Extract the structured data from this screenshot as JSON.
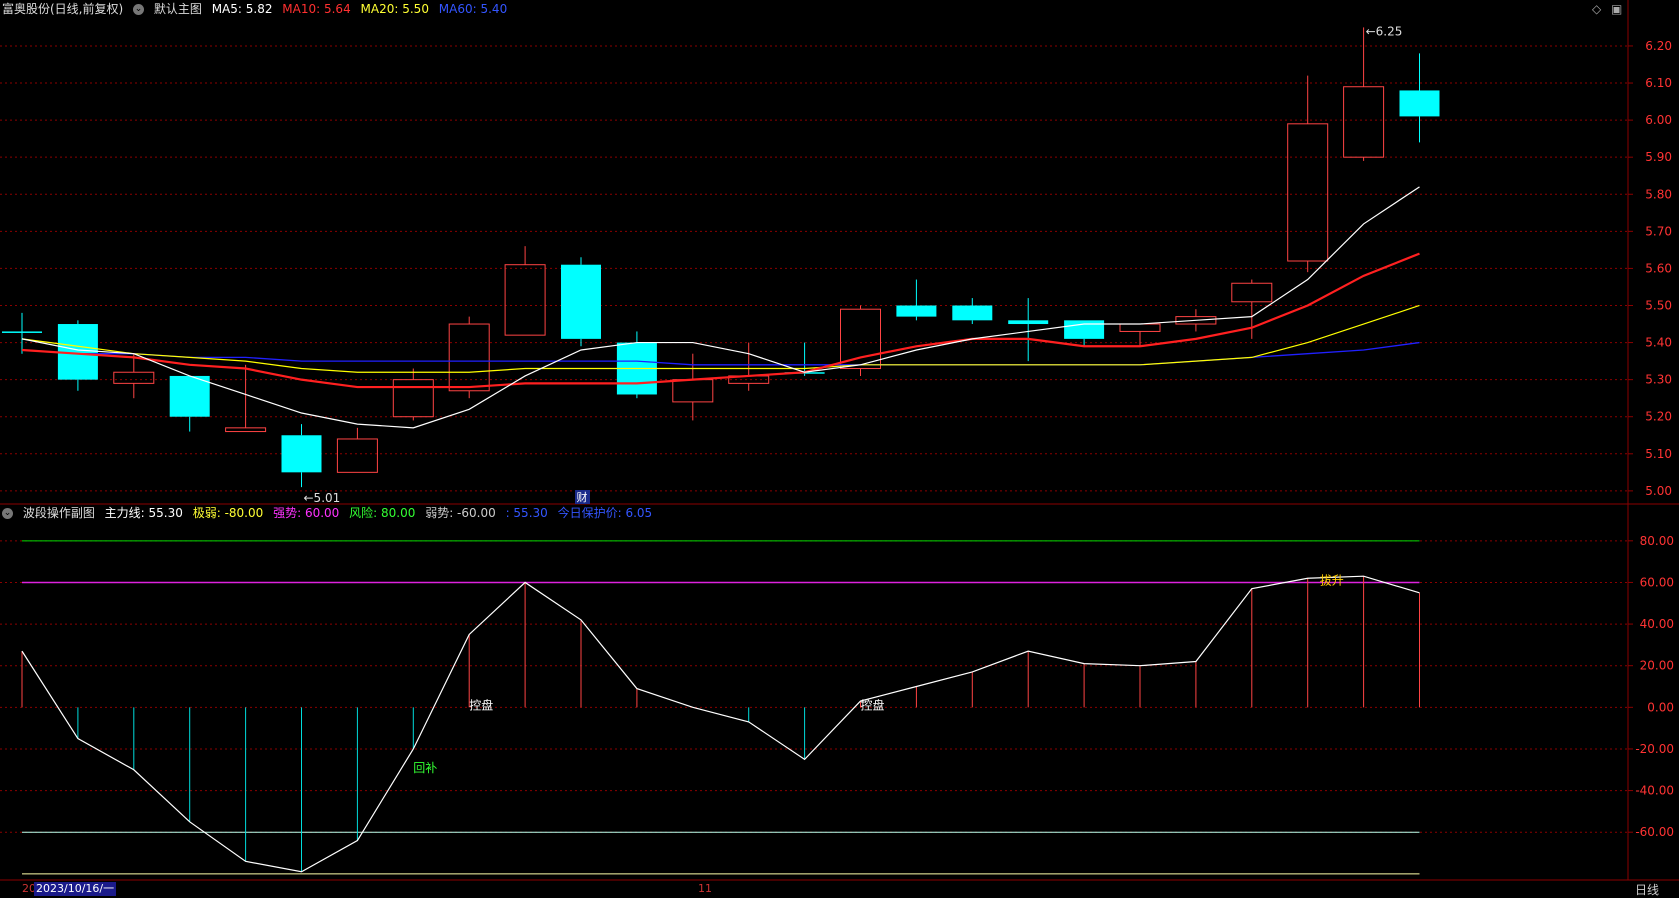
{
  "main_header": {
    "stock": "富奥股份(日线,前复权)",
    "chart_name": "默认主图",
    "ma5": "MA5: 5.82",
    "ma10": "MA10: 5.64",
    "ma20": "MA20: 5.50",
    "ma60": "MA60: 5.40"
  },
  "sub_header": {
    "name": "波段操作副图",
    "main_line": "主力线: 55.30",
    "extreme_weak": "极弱: -80.00",
    "strong": "强势: 60.00",
    "risk": "风险: 80.00",
    "weak": "弱势: -60.00",
    "value": ": 55.30",
    "today_price": "今日保护价: 6.05"
  },
  "colors": {
    "up": "#ff4444",
    "down": "#00ffff",
    "ma5": "#ffffff",
    "ma10": "#ff2020",
    "ma20": "#ffff00",
    "ma60": "#2020ff",
    "grid": "#8b0000"
  },
  "chart_data": [
    {
      "type": "candlestick",
      "ylim": [
        4.97,
        6.27
      ],
      "y_ticks": [
        "6.20",
        "6.10",
        "6.00",
        "5.90",
        "5.80",
        "5.70",
        "5.60",
        "5.50",
        "5.40",
        "5.30",
        "5.20",
        "5.10",
        "5.00"
      ],
      "candles": [
        {
          "o": 5.43,
          "h": 5.48,
          "l": 5.37,
          "c": 5.43
        },
        {
          "o": 5.45,
          "h": 5.46,
          "l": 5.27,
          "c": 5.3
        },
        {
          "o": 5.29,
          "h": 5.37,
          "l": 5.25,
          "c": 5.32
        },
        {
          "o": 5.31,
          "h": 5.31,
          "l": 5.16,
          "c": 5.2
        },
        {
          "o": 5.16,
          "h": 5.34,
          "l": 5.16,
          "c": 5.17
        },
        {
          "o": 5.15,
          "h": 5.18,
          "l": 5.01,
          "c": 5.05
        },
        {
          "o": 5.05,
          "h": 5.17,
          "l": 5.05,
          "c": 5.14
        },
        {
          "o": 5.2,
          "h": 5.33,
          "l": 5.19,
          "c": 5.3
        },
        {
          "o": 5.27,
          "h": 5.47,
          "l": 5.25,
          "c": 5.45
        },
        {
          "o": 5.42,
          "h": 5.66,
          "l": 5.42,
          "c": 5.61
        },
        {
          "o": 5.61,
          "h": 5.63,
          "l": 5.39,
          "c": 5.41
        },
        {
          "o": 5.4,
          "h": 5.43,
          "l": 5.25,
          "c": 5.26
        },
        {
          "o": 5.24,
          "h": 5.37,
          "l": 5.19,
          "c": 5.3
        },
        {
          "o": 5.29,
          "h": 5.4,
          "l": 5.27,
          "c": 5.31
        },
        {
          "o": 5.32,
          "h": 5.4,
          "l": 5.31,
          "c": 5.32
        },
        {
          "o": 5.33,
          "h": 5.5,
          "l": 5.31,
          "c": 5.49
        },
        {
          "o": 5.5,
          "h": 5.57,
          "l": 5.46,
          "c": 5.47
        },
        {
          "o": 5.5,
          "h": 5.52,
          "l": 5.45,
          "c": 5.46
        },
        {
          "o": 5.46,
          "h": 5.52,
          "l": 5.35,
          "c": 5.45
        },
        {
          "o": 5.46,
          "h": 5.46,
          "l": 5.39,
          "c": 5.41
        },
        {
          "o": 5.43,
          "h": 5.45,
          "l": 5.39,
          "c": 5.45
        },
        {
          "o": 5.45,
          "h": 5.49,
          "l": 5.43,
          "c": 5.47
        },
        {
          "o": 5.51,
          "h": 5.57,
          "l": 5.41,
          "c": 5.56
        },
        {
          "o": 5.62,
          "h": 6.12,
          "l": 5.59,
          "c": 5.99
        },
        {
          "o": 5.9,
          "h": 6.25,
          "l": 5.89,
          "c": 6.09
        },
        {
          "o": 6.08,
          "h": 6.18,
          "l": 5.94,
          "c": 6.01
        }
      ],
      "ma5": [
        5.41,
        5.38,
        5.37,
        5.31,
        5.26,
        5.21,
        5.18,
        5.17,
        5.22,
        5.31,
        5.38,
        5.4,
        5.4,
        5.37,
        5.32,
        5.34,
        5.38,
        5.41,
        5.43,
        5.45,
        5.45,
        5.46,
        5.47,
        5.57,
        5.72,
        5.82
      ],
      "ma10": [
        5.38,
        5.37,
        5.36,
        5.34,
        5.33,
        5.3,
        5.28,
        5.28,
        5.28,
        5.29,
        5.29,
        5.29,
        5.3,
        5.31,
        5.32,
        5.36,
        5.39,
        5.41,
        5.41,
        5.39,
        5.39,
        5.41,
        5.44,
        5.5,
        5.58,
        5.64
      ],
      "ma20": [
        5.41,
        5.39,
        5.37,
        5.36,
        5.35,
        5.33,
        5.32,
        5.32,
        5.32,
        5.33,
        5.33,
        5.33,
        5.33,
        5.33,
        5.33,
        5.34,
        5.34,
        5.34,
        5.34,
        5.34,
        5.34,
        5.35,
        5.36,
        5.4,
        5.45,
        5.5
      ],
      "ma60": [
        5.38,
        5.37,
        5.37,
        5.36,
        5.36,
        5.35,
        5.35,
        5.35,
        5.35,
        5.35,
        5.35,
        5.35,
        5.34,
        5.34,
        5.34,
        5.34,
        5.34,
        5.34,
        5.34,
        5.34,
        5.34,
        5.35,
        5.36,
        5.37,
        5.38,
        5.4
      ],
      "annotations": {
        "low": "←5.01",
        "high": "←6.25",
        "finance": "财"
      }
    },
    {
      "type": "line",
      "ylim": [
        -82,
        90
      ],
      "y_ticks": [
        "80.00",
        "60.00",
        "40.00",
        "20.00",
        "0.00",
        "-20.00",
        "-40.00",
        "-60.00"
      ],
      "main_line": [
        27,
        -15,
        -30,
        -55,
        -74,
        -79,
        -64,
        -20,
        35,
        60,
        42,
        9,
        0,
        -7,
        -25,
        3,
        10,
        17,
        27,
        21,
        20,
        22,
        57,
        62,
        63,
        55
      ],
      "levels": {
        "risk": 80,
        "strong": 60,
        "weak": -60,
        "extreme_weak": -80
      },
      "labels": {
        "kongpan1": "控盘",
        "huibu": "回补",
        "kongpan2": "控盘",
        "lasheng": "拔升"
      }
    }
  ],
  "footer": {
    "date_prefix": "20",
    "date": "2023/10/16/一",
    "month_tick": "11",
    "period": "日线"
  },
  "corner": {
    "diamond": "◇",
    "box": "▣"
  }
}
